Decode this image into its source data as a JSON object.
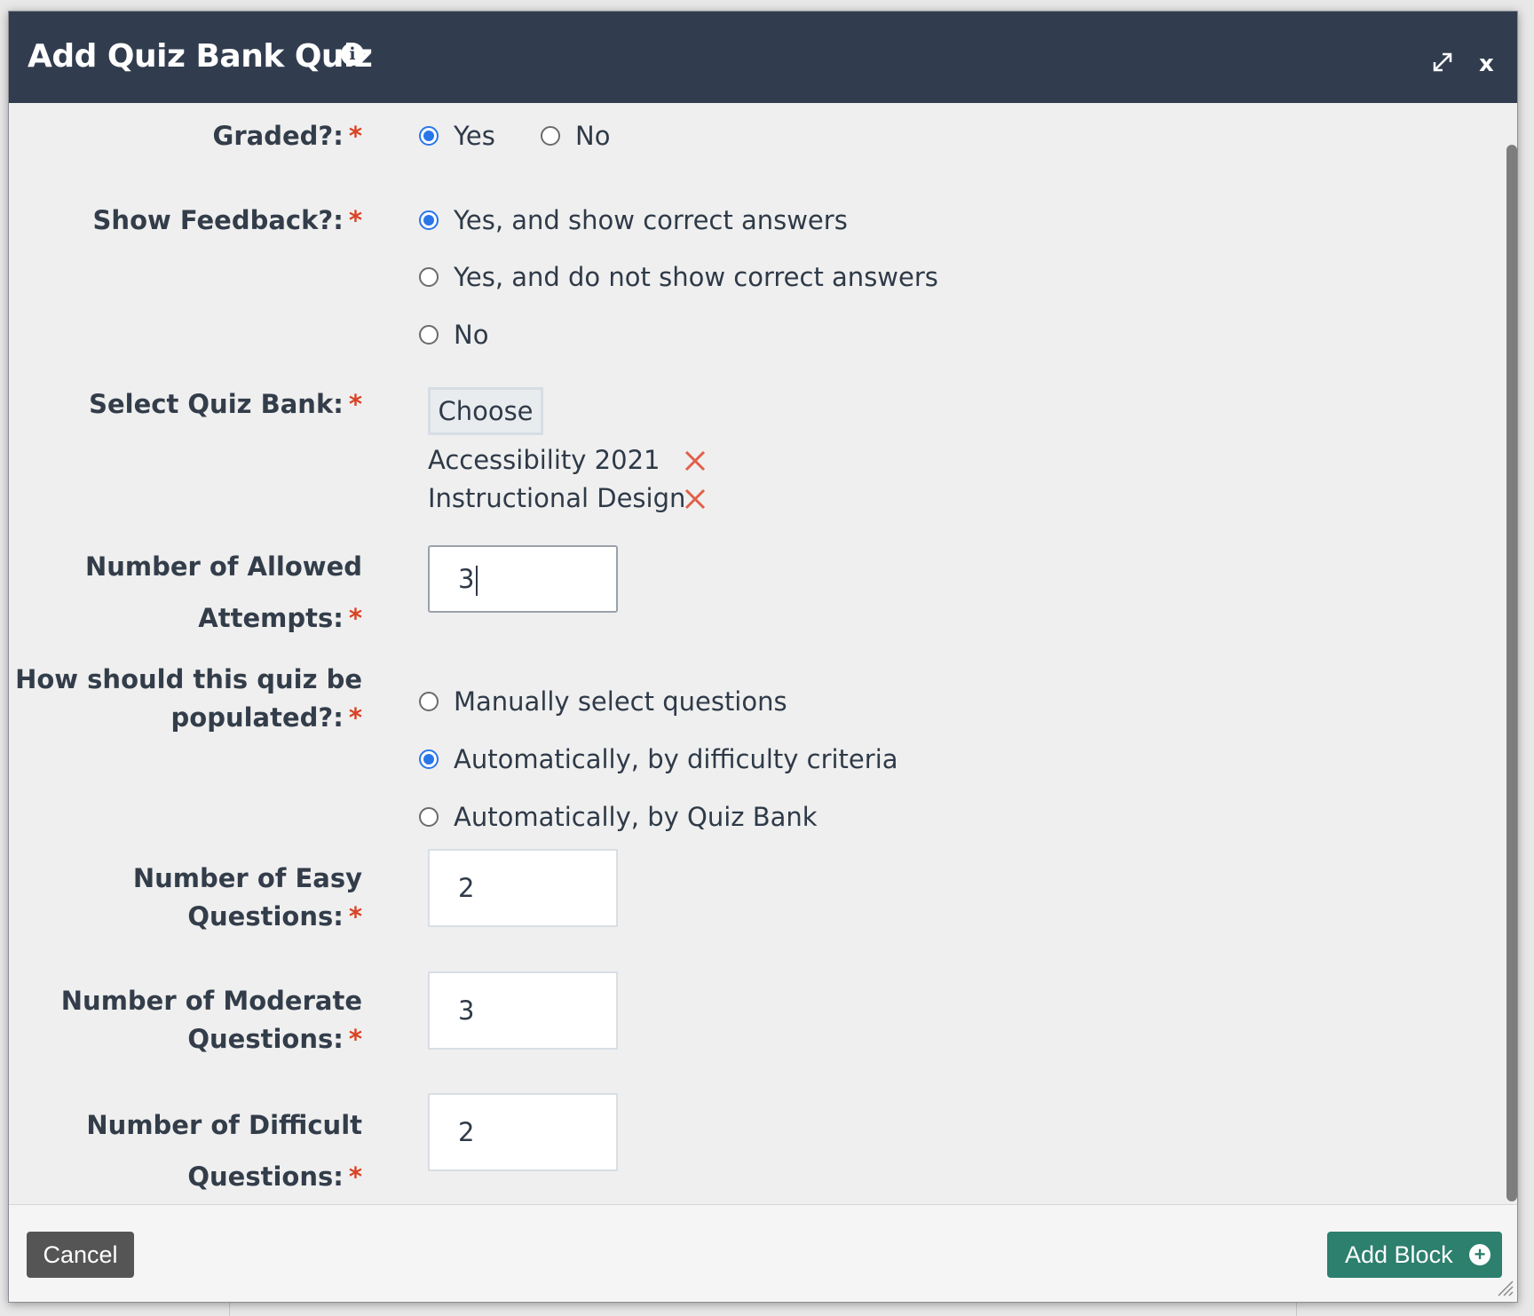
{
  "dialog": {
    "title": "Add Quiz Bank Quiz",
    "close_label": "x"
  },
  "form": {
    "graded": {
      "label": "Graded?:",
      "options": [
        {
          "label": "Yes",
          "checked": true
        },
        {
          "label": "No",
          "checked": false
        }
      ]
    },
    "show_feedback": {
      "label": "Show Feedback?:",
      "options": [
        {
          "label": "Yes, and show correct answers",
          "checked": true
        },
        {
          "label": "Yes, and do not show correct answers",
          "checked": false
        },
        {
          "label": "No",
          "checked": false
        }
      ]
    },
    "quiz_bank": {
      "label": "Select Quiz Bank:",
      "choose_label": "Choose",
      "selected": [
        "Accessibility 2021",
        "Instructional Design"
      ]
    },
    "allowed_attempts": {
      "label_line1": "Number of Allowed",
      "label_line2": "Attempts:",
      "value": "3"
    },
    "populate": {
      "label_line1": "How should this quiz be",
      "label_line2": "populated?:",
      "options": [
        {
          "label": "Manually select questions",
          "checked": false
        },
        {
          "label": "Automatically, by difficulty criteria",
          "checked": true
        },
        {
          "label": "Automatically, by Quiz Bank",
          "checked": false
        }
      ]
    },
    "easy": {
      "label_line1": "Number of Easy",
      "label_line2": "Questions:",
      "value": "2"
    },
    "moderate": {
      "label_line1": "Number of Moderate",
      "label_line2": "Questions:",
      "value": "3"
    },
    "difficult": {
      "label_line1": "Number of Difficult",
      "label_line2": "Questions:",
      "value": "2"
    },
    "required_marker": "*"
  },
  "footer": {
    "cancel_label": "Cancel",
    "add_label": "Add Block"
  },
  "colors": {
    "titlebar": "#313d4f",
    "required": "#d84325",
    "radio_checked": "#2a76e8",
    "add_button": "#2d7f6e",
    "remove_x": "#e0604a"
  },
  "icons": [
    "info-icon",
    "expand-icon",
    "close-icon",
    "remove-icon",
    "plus-circle-icon",
    "resize-handle-icon"
  ]
}
